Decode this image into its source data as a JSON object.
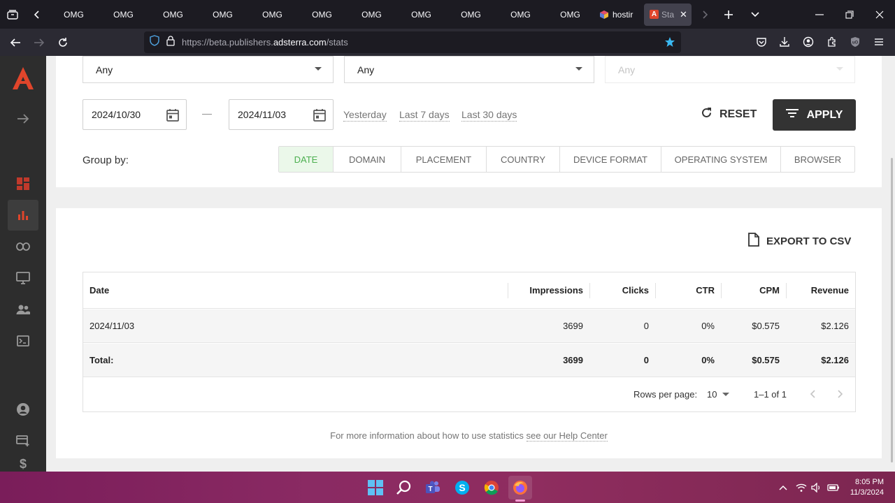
{
  "browser": {
    "tabs": [
      "OMG",
      "OMG",
      "OMG",
      "OMG",
      "OMG",
      "OMG",
      "OMG",
      "OMG",
      "OMG",
      "OMG",
      "OMG"
    ],
    "hosting_tab_label": "hostir",
    "active_tab_label": "Sta",
    "url_prefix": "https://beta.publishers.",
    "url_domain": "adsterra.com",
    "url_path": "/stats"
  },
  "filters": {
    "select1_value": "Any",
    "select2_value": "Any",
    "select3_placeholder": "Any",
    "date_from": "2024/10/30",
    "date_separator": "—",
    "date_to": "2024/11/03",
    "quick_ranges": [
      "Yesterday",
      "Last 7 days",
      "Last 30 days"
    ],
    "reset_label": "RESET",
    "apply_label": "APPLY",
    "group_by_label": "Group by:",
    "group_by_options": [
      "DATE",
      "DOMAIN",
      "PLACEMENT",
      "COUNTRY",
      "DEVICE FORMAT",
      "OPERATING SYSTEM",
      "BROWSER"
    ],
    "group_by_selected": "DATE"
  },
  "stats": {
    "export_label": "EXPORT TO CSV",
    "columns": [
      "Date",
      "Impressions",
      "Clicks",
      "CTR",
      "CPM",
      "Revenue"
    ],
    "rows": [
      {
        "date": "2024/11/03",
        "impressions": "3699",
        "clicks": "0",
        "ctr": "0%",
        "cpm": "$0.575",
        "revenue": "$2.126"
      }
    ],
    "total": {
      "label": "Total:",
      "impressions": "3699",
      "clicks": "0",
      "ctr": "0%",
      "cpm": "$0.575",
      "revenue": "$2.126"
    },
    "rows_per_page_label": "Rows per page:",
    "rows_per_page_value": "10",
    "range_text": "1–1 of 1",
    "help_text": "For more information about how to use statistics ",
    "help_link": "see our Help Center"
  },
  "taskbar": {
    "time": "8:05 PM",
    "date": "11/3/2024"
  },
  "colors": {
    "brand_orange": "#e0452b",
    "accent_green": "#4caf50",
    "apply_bg": "#333333",
    "taskbar_magenta": "#8a2a63"
  }
}
